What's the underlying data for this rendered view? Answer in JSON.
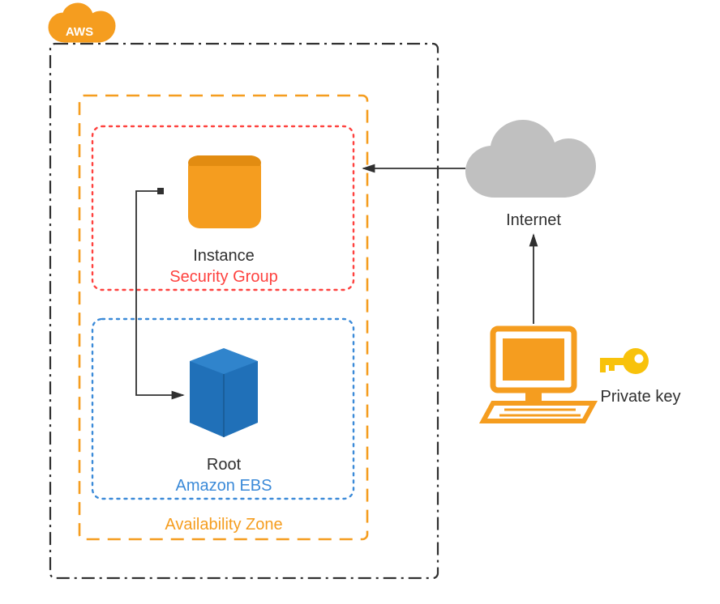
{
  "diagram": {
    "aws_label": "AWS",
    "availability_zone_label": "Availability Zone",
    "security_group_label": "Security Group",
    "instance_label": "Instance",
    "root_label": "Root",
    "amazon_ebs_label": "Amazon EBS",
    "internet_label": "Internet",
    "private_key_label": "Private key",
    "colors": {
      "aws_orange": "#F59D1F",
      "aws_orange_dark": "#E28C11",
      "box_blue": "#2070B8",
      "box_blue_dark": "#185A93",
      "sg_red": "#FE423F",
      "ebs_blue": "#3B8AD8",
      "grey_cloud": "#C0C0C0",
      "key_yellow": "#F8C20B"
    }
  }
}
